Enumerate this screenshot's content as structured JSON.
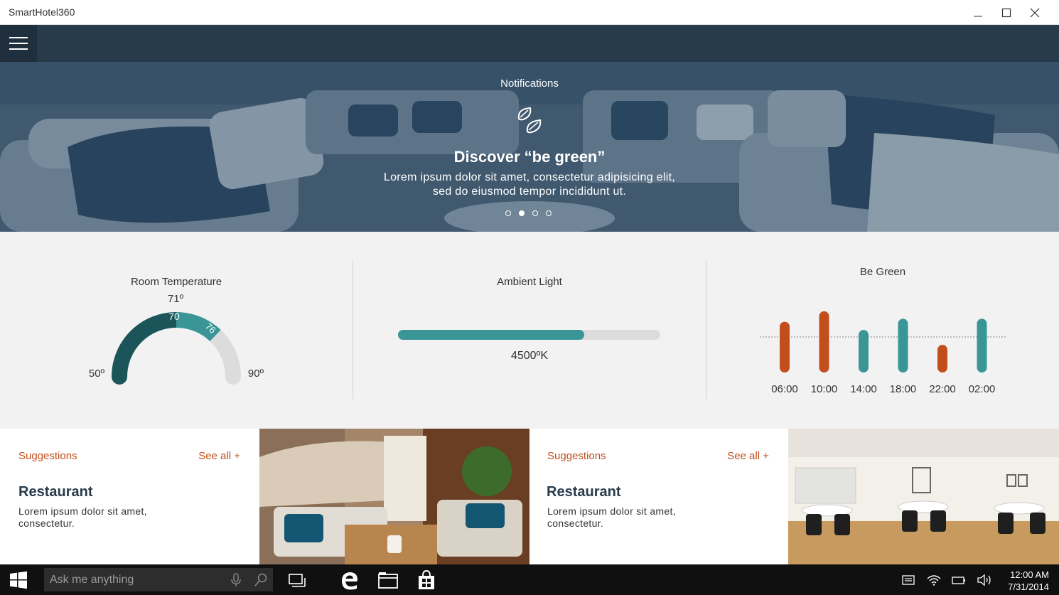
{
  "window": {
    "title": "SmartHotel360"
  },
  "hero": {
    "section_title": "Notifications",
    "headline": "Discover “be green”",
    "body_line1": "Lorem ipsum dolor sit amet, consectetur adipisicing elit,",
    "body_line2": "sed do eiusmod tempor incididunt ut.",
    "carousel_count": 4,
    "carousel_active": 2
  },
  "widgets": {
    "temperature": {
      "title": "Room Temperature",
      "target_label": "71º",
      "current_label": "70",
      "setpoint_label": "76",
      "min_label": "50º",
      "max_label": "90º",
      "min": 50,
      "max": 90,
      "current": 70,
      "setpoint": 76
    },
    "light": {
      "title": "Ambient Light",
      "value_label": "4500ºK",
      "fill_fraction": 0.71
    },
    "green": {
      "title": "Be Green",
      "chart_data": {
        "type": "bar",
        "categories": [
          "06:00",
          "10:00",
          "14:00",
          "18:00",
          "22:00",
          "02:00"
        ],
        "values": [
          68,
          82,
          57,
          72,
          37,
          72
        ],
        "baseline": 36,
        "colors": [
          "#c24e1c",
          "#c24e1c",
          "#3a9596",
          "#3a9596",
          "#c24e1c",
          "#3a9596"
        ]
      }
    }
  },
  "suggestions": [
    {
      "label": "Suggestions",
      "see_all": "See all +",
      "title": "Restaurant",
      "text": "Lorem ipsum dolor sit amet, consectetur."
    },
    {
      "label": "Suggestions",
      "see_all": "See all +",
      "title": "Restaurant",
      "text": "Lorem ipsum dolor sit amet, consectetur."
    }
  ],
  "taskbar": {
    "search_placeholder": "Ask me anything",
    "time": "12:00 AM",
    "date": "7/31/2014"
  },
  "colors": {
    "header": "#283b4b",
    "accent_orange": "#c24e1c",
    "accent_teal": "#3a9596",
    "dark_teal": "#1b5559"
  }
}
